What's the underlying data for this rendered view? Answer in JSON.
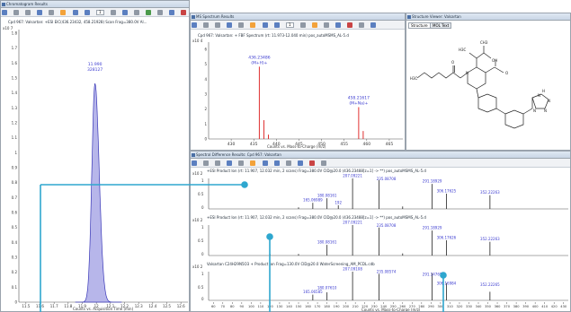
{
  "chromatogram": {
    "title": "Chromatogram Results",
    "page_input": "1",
    "trace_label": "Cpd 967: Valsartan: +ESI EIC(436.23432, 458.21928) Scan Frag=380.0V Al...",
    "y_scale": "x10 7",
    "peak_rt": "11.990",
    "peak_area": "328127",
    "x_axis_title": "Counts vs. Acquisition Time (min)",
    "x_ticks": [
      "11.5",
      "11.6",
      "11.7",
      "11.8",
      "11.9",
      "12",
      "12.1",
      "12.2",
      "12.3",
      "12.4",
      "12.5",
      "12.6"
    ],
    "y_ticks": [
      "1.8",
      "1.7",
      "1.6",
      "1.5",
      "1.4",
      "1.3",
      "1.2",
      "1.1",
      "1",
      "0.9",
      "0.8",
      "0.7",
      "0.6",
      "0.5",
      "0.4",
      "0.3",
      "0.2",
      "0.1",
      "0"
    ]
  },
  "ms_spectrum": {
    "title": "MS Spectrum Results",
    "page_input": "1",
    "trace_label": "Cpd 967: Valsartan: + FBF Spectrum (rt: 11.973-12.040 min) pos_autoMSMS_AL-5.d",
    "y_scale": "x10 4",
    "peak1_mz": "436.23486",
    "peak1_ion": "(M+H)+",
    "peak2_mz": "458.21617",
    "peak2_ion": "(M+Na)+",
    "x_axis_title": "Counts vs. Mass-to-Charge (m/z)",
    "x_ticks": [
      "430",
      "435",
      "440",
      "445",
      "450",
      "455",
      "460",
      "465"
    ],
    "y_ticks": [
      "6",
      "5",
      "4",
      "3",
      "2",
      "1",
      "0"
    ]
  },
  "structure": {
    "title": "Structure Viewer: Valsartan",
    "tabs": [
      "Structure",
      "MOL Text"
    ],
    "groups": [
      "H3C",
      "H3C",
      "CH3",
      "OH",
      "O",
      "O",
      "N",
      "H",
      "N",
      "N",
      "N",
      "N"
    ]
  },
  "spectral": {
    "title": "Spectral Difference Results: Cpd 967: Valsartan",
    "x_axis_title": "Counts vs. Mass-to-Charge (m/z)",
    "x_ticks": [
      "60",
      "70",
      "80",
      "90",
      "100",
      "110",
      "120",
      "130",
      "140",
      "150",
      "160",
      "170",
      "180",
      "190",
      "200",
      "210",
      "220",
      "230",
      "240",
      "250",
      "260",
      "270",
      "280",
      "290",
      "300",
      "310",
      "320",
      "330",
      "340",
      "350",
      "360",
      "370",
      "380",
      "390",
      "400",
      "410",
      "420",
      "430"
    ],
    "traces": [
      {
        "label": "+ESI Product Ion (rt: 11.907, 12.032 min, 2 scans) Frag=380.0V CID@20.0 (436.23488[z=1] -> **) pos_autoMSMS_AL-5.d",
        "y_scale": "x10 2",
        "y_ticks": [
          "1",
          "0.5",
          "0"
        ],
        "peaks": [
          "207.09221",
          "235.08708",
          "291.18929",
          "306.17625",
          "352.22263",
          "180.08161",
          "165.06989",
          "192"
        ]
      },
      {
        "label": "+ESI Product Ion (rt: 11.907, 12.032 min, 2 scans) Frag=380.0V CID@20.0 (436.23488[z=1] -> **) pos_autoMSMS_AL-5.d",
        "y_scale": "x10 2",
        "y_ticks": [
          "1",
          "0.5",
          "0"
        ],
        "peaks": [
          "207.09221",
          "235.08708",
          "291.18929",
          "306.17626",
          "352.22263",
          "180.08161"
        ]
      },
      {
        "label": "Valsartan C24H29N5O3 + Product Ion Frag=130.0V CID@20.0 WaterScreening_AM_PCDL.cdb",
        "y_scale": "x10 2",
        "y_ticks": [
          "1",
          "0.5",
          "0"
        ],
        "peaks": [
          "207.09108",
          "235.08574",
          "291.14765",
          "306.16984",
          "352.22265",
          "180.07610",
          "165.06585"
        ]
      }
    ]
  },
  "colors": {
    "chrom_fill": "#b7b6ea",
    "chrom_line": "#3a38b8",
    "ms_peak": "#e03030",
    "peak_blue": "#3a3ad0",
    "callout": "#2ea7cf"
  }
}
